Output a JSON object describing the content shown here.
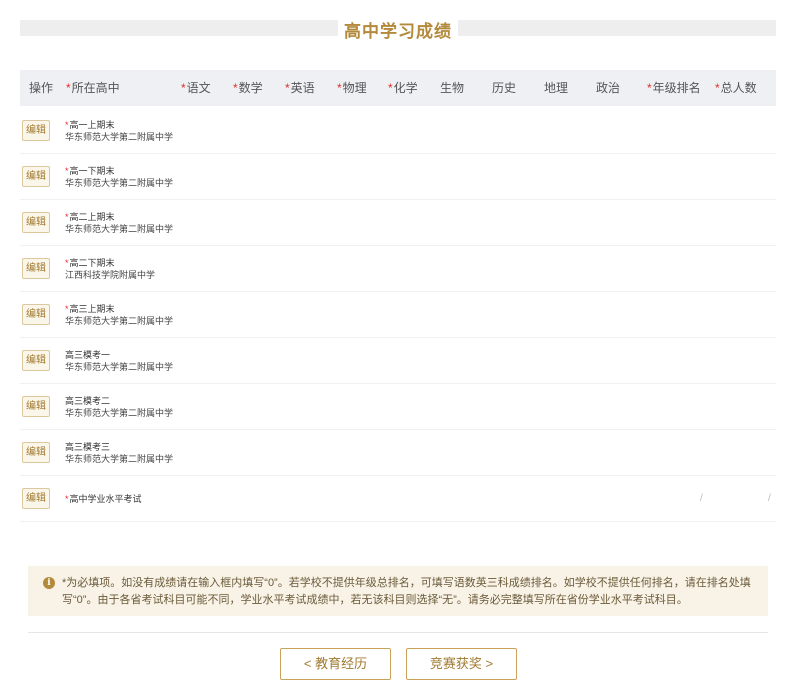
{
  "section": {
    "title": "高中学习成绩"
  },
  "table": {
    "headers": [
      {
        "label": "操作",
        "required": false
      },
      {
        "label": "所在高中",
        "required": true
      },
      {
        "label": "语文",
        "required": true
      },
      {
        "label": "数学",
        "required": true
      },
      {
        "label": "英语",
        "required": true
      },
      {
        "label": "物理",
        "required": true
      },
      {
        "label": "化学",
        "required": true
      },
      {
        "label": "生物",
        "required": false
      },
      {
        "label": "历史",
        "required": false
      },
      {
        "label": "地理",
        "required": false
      },
      {
        "label": "政治",
        "required": false
      },
      {
        "label": "年级排名",
        "required": true
      },
      {
        "label": "总人数",
        "required": true
      }
    ],
    "required_mark": "*",
    "edit_label": "编辑",
    "rows": [
      {
        "term": "高一上期末",
        "required": true,
        "school": "华东师范大学第二附属中学"
      },
      {
        "term": "高一下期末",
        "required": true,
        "school": "华东师范大学第二附属中学"
      },
      {
        "term": "高二上期末",
        "required": true,
        "school": "华东师范大学第二附属中学"
      },
      {
        "term": "高二下期末",
        "required": true,
        "school": "江西科技学院附属中学"
      },
      {
        "term": "高三上期末",
        "required": true,
        "school": "华东师范大学第二附属中学"
      },
      {
        "term": "高三模考一",
        "required": false,
        "school": "华东师范大学第二附属中学"
      },
      {
        "term": "高三模考二",
        "required": false,
        "school": "华东师范大学第二附属中学"
      },
      {
        "term": "高三模考三",
        "required": false,
        "school": "华东师范大学第二附属中学"
      },
      {
        "term": "高中学业水平考试",
        "required": true,
        "school": "",
        "rank": "/",
        "total": "/"
      }
    ]
  },
  "notice": {
    "icon": "info-icon",
    "text": "*为必填项。如没有成绩请在输入框内填写“0”。若学校不提供年级总排名，可填写语数英三科成绩排名。如学校不提供任何排名，请在排名处填写“0”。由于各省考试科目可能不同，学业水平考试成绩中，若无该科目则选择“无”。请务必完整填写所在省份学业水平考试科目。"
  },
  "nav": {
    "prev_label": "< 教育经历",
    "next_label": "竞赛获奖 >"
  },
  "colors": {
    "accent": "#b38a3c",
    "required": "#e0302a",
    "notice_bg": "#f8f3e6"
  }
}
